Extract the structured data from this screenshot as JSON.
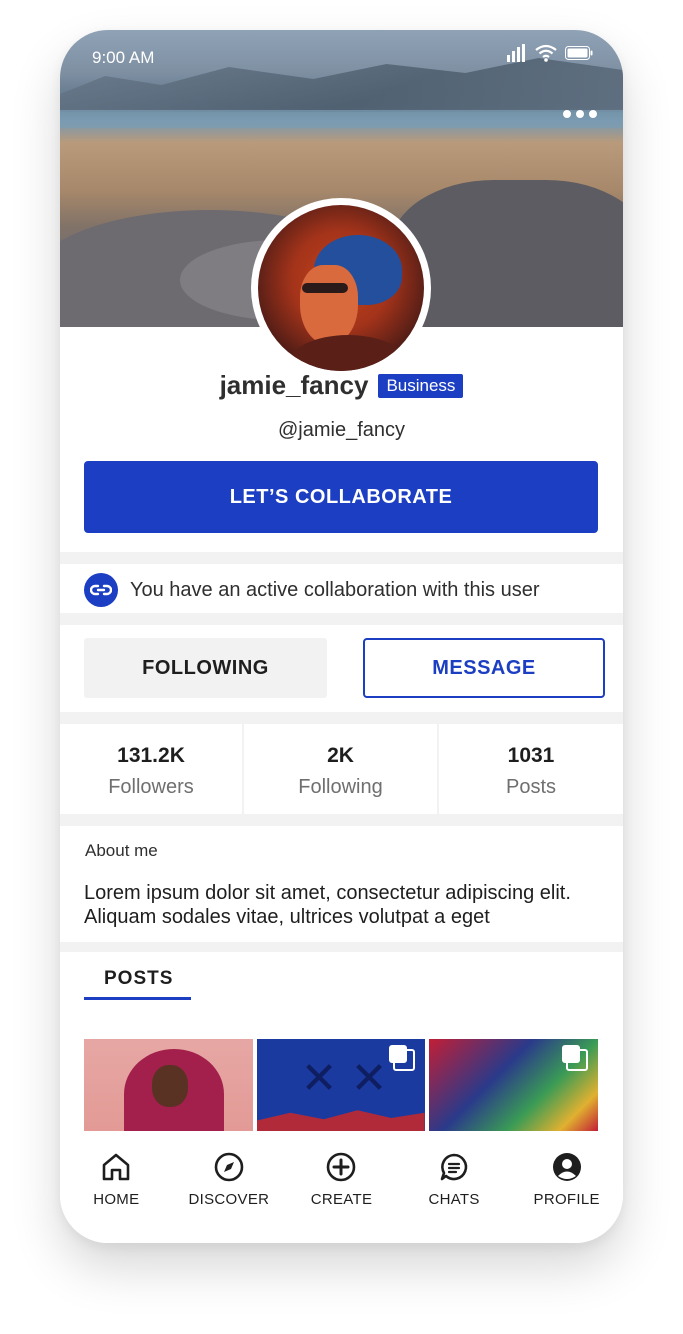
{
  "status_bar": {
    "time": "9:00 AM"
  },
  "profile": {
    "username": "jamie_fancy",
    "badge": "Business",
    "handle": "@jamie_fancy",
    "collaborate_label": "LET’S COLLABORATE",
    "collab_notice": "You have an active collaboration with this user",
    "following_label": "FOLLOWING",
    "message_label": "MESSAGE"
  },
  "stats": [
    {
      "value": "131.2K",
      "label": "Followers"
    },
    {
      "value": "2K",
      "label": "Following"
    },
    {
      "value": "1031",
      "label": "Posts"
    }
  ],
  "about": {
    "title": "About me",
    "text": "Lorem ipsum dolor sit amet, consectetur adipiscing elit. Aliquam sodales vitae, ultrices volutpat a eget"
  },
  "posts": {
    "tab_label": "POSTS"
  },
  "tabbar": [
    {
      "label": "HOME",
      "icon": "home-icon"
    },
    {
      "label": "DISCOVER",
      "icon": "compass-icon"
    },
    {
      "label": "CREATE",
      "icon": "plus-circle-icon"
    },
    {
      "label": "CHATS",
      "icon": "chat-icon"
    },
    {
      "label": "PROFILE",
      "icon": "user-circle-icon"
    }
  ],
  "colors": {
    "accent": "#1b3ec2",
    "divider": "#f2f2f2",
    "muted_text": "#6f6f6f"
  }
}
